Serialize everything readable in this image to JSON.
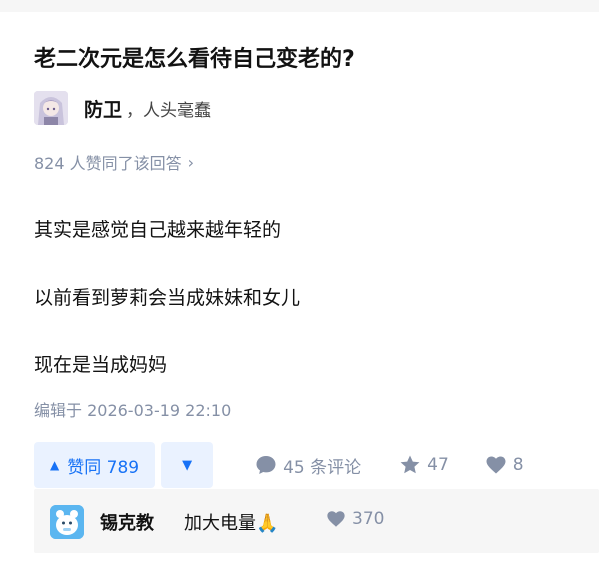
{
  "question": {
    "title": "老二次元是怎么看待自己变老的?"
  },
  "author": {
    "name": "防卫",
    "bio": "，人头毫蠢"
  },
  "answer": {
    "votes_text": "824 人赞同了该回答",
    "paragraphs": [
      "其实是感觉自己越来越年轻的",
      "以前看到萝莉会当成妹妹和女儿",
      "现在是当成妈妈"
    ],
    "edited": "编辑于 2026-03-19 22:10"
  },
  "actions": {
    "upvote_label": "赞同 789",
    "comments_label": "45 条评论",
    "collections": "47",
    "likes": "8"
  },
  "top_comment": {
    "user": "锡克教",
    "text": "加大电量🙏",
    "likes": "370"
  },
  "colors": {
    "accent": "#1772f6",
    "muted": "#8590a6"
  },
  "icons": {
    "upvote": "triangle-up",
    "downvote": "triangle-down",
    "comment": "speech-bubble",
    "star": "star",
    "heart": "heart",
    "chevron": "chevron-right"
  }
}
